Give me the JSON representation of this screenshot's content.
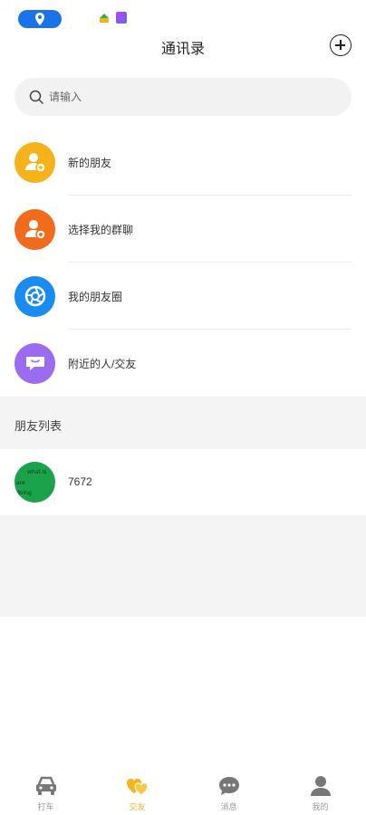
{
  "header": {
    "title": "通讯录"
  },
  "search": {
    "placeholder": "请输入"
  },
  "menu": [
    {
      "label": "新的朋友",
      "icon": "add-user-icon",
      "color": "#f6b21a"
    },
    {
      "label": "选择我的群聊",
      "icon": "group-icon",
      "color": "#f06c1c"
    },
    {
      "label": "我的朋友圈",
      "icon": "aperture-icon",
      "color": "#1a8cf0"
    },
    {
      "label": "附近的人/交友",
      "icon": "chat-bubble-icon",
      "color": "#9b6cf0"
    }
  ],
  "friends_section": {
    "title": "朋友列表"
  },
  "friends": [
    {
      "name": "7672",
      "avatar_lines": [
        "what is",
        "are",
        "doing"
      ]
    }
  ],
  "tabs": [
    {
      "label": "打车",
      "icon": "car-icon",
      "active": false
    },
    {
      "label": "交友",
      "icon": "hearts-icon",
      "active": true
    },
    {
      "label": "消息",
      "icon": "message-icon",
      "active": false
    },
    {
      "label": "我的",
      "icon": "person-icon",
      "active": false
    }
  ],
  "colors": {
    "accent": "#f2b51f",
    "location_pill": "#1a73e8"
  }
}
